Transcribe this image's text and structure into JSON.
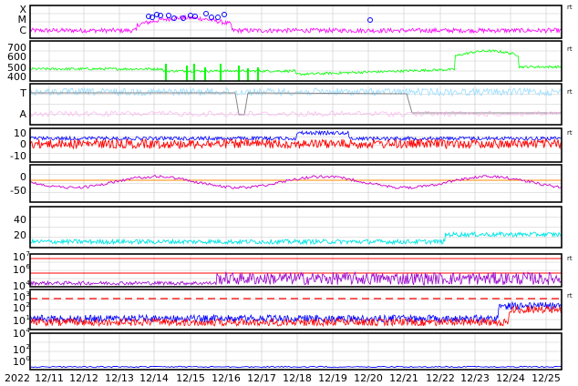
{
  "x_axis": {
    "year_label": "2022",
    "tick_labels": [
      "12/11",
      "12/12",
      "12/13",
      "12/14",
      "12/15",
      "12/16",
      "12/17",
      "12/18",
      "12/19",
      "12/20",
      "12/21",
      "12/22",
      "12/23",
      "12/24",
      "12/25"
    ]
  },
  "colors": {
    "magenta": "#ff00ff",
    "green": "#00ff00",
    "lightblue": "#99ddff",
    "pink": "#ffaaee",
    "gray": "#888888",
    "blue": "#0000ff",
    "red": "#ff0000",
    "purple": "#cc00cc",
    "darkpurple": "#9900cc",
    "cyan": "#00e5e5",
    "orange": "#ff8800",
    "black": "#000000",
    "grid": "#c8c8c8"
  },
  "chart_data": [
    {
      "type": "scatter",
      "categories": [
        "C",
        "M",
        "X"
      ],
      "annotations": [
        "rt"
      ],
      "series": [
        {
          "color": "#ff00ff"
        }
      ],
      "notes": "flare-class activity trace with circle markers near M/X levels"
    },
    {
      "type": "line",
      "ylim": [
        300,
        780
      ],
      "ytick_labels": [
        "400",
        "500",
        "600",
        "700"
      ],
      "annotations": [
        "rt"
      ],
      "series": [
        {
          "color": "#00ff00"
        }
      ]
    },
    {
      "type": "line",
      "categories": [
        "A",
        "T"
      ],
      "annotations": [
        "rt"
      ],
      "series": [
        {
          "color": "#99ddff"
        },
        {
          "color": "#ffaaee"
        },
        {
          "color": "#888888"
        }
      ]
    },
    {
      "type": "line",
      "ylim": [
        -20,
        15
      ],
      "ytick_labels": [
        "-10",
        "0",
        "10"
      ],
      "annotations": [
        "rt"
      ],
      "series": [
        {
          "color": "#0000ff"
        },
        {
          "color": "#ff0000"
        }
      ]
    },
    {
      "type": "line",
      "ylim": [
        -80,
        30
      ],
      "ytick_labels": [
        "-50",
        "0"
      ],
      "series": [
        {
          "color": "#cc00cc"
        },
        {
          "color": "#ff8800"
        }
      ]
    },
    {
      "type": "line",
      "ylim": [
        0,
        55
      ],
      "ytick_labels": [
        "20",
        "40"
      ],
      "series": [
        {
          "color": "#00e5e5"
        }
      ]
    },
    {
      "type": "line",
      "scale": "log",
      "ytick_labels": [
        "10",
        "10"
      ],
      "ytick_exponents": [
        "6",
        "7"
      ],
      "annotations": [
        "rt"
      ],
      "series": [
        {
          "color": "#9900cc"
        },
        {
          "color": "#ff0000"
        }
      ]
    },
    {
      "type": "line",
      "scale": "log",
      "ytick_labels": [
        "10",
        "10",
        "10",
        "10"
      ],
      "ytick_exponents": [
        "1",
        "2",
        "3",
        "4"
      ],
      "annotations": [
        "rt"
      ],
      "series": [
        {
          "color": "#0000ff"
        },
        {
          "color": "#ff0000"
        }
      ]
    },
    {
      "type": "line",
      "scale": "log",
      "ytick_labels": [
        "10",
        "10",
        "10"
      ],
      "ytick_exponents": [
        "0",
        "2",
        "4"
      ],
      "series": [
        {
          "color": "#0000ff"
        }
      ]
    }
  ]
}
